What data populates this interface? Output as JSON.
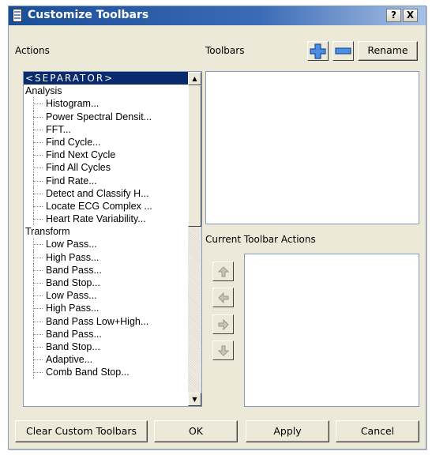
{
  "window": {
    "title": "Customize Toolbars",
    "help_label": "?",
    "close_label": "X"
  },
  "actions": {
    "label": "Actions",
    "items": [
      {
        "text": "<SEPARATOR>",
        "type": "selected"
      },
      {
        "text": "Analysis",
        "type": "group"
      },
      {
        "text": "Histogram...",
        "type": "child"
      },
      {
        "text": "Power Spectral Densit...",
        "type": "child"
      },
      {
        "text": "FFT...",
        "type": "child"
      },
      {
        "text": "Find Cycle...",
        "type": "child"
      },
      {
        "text": "Find Next Cycle",
        "type": "child"
      },
      {
        "text": "Find All Cycles",
        "type": "child"
      },
      {
        "text": "Find Rate...",
        "type": "child"
      },
      {
        "text": "Detect and Classify H...",
        "type": "child"
      },
      {
        "text": "Locate ECG Complex ...",
        "type": "child"
      },
      {
        "text": "Heart Rate Variability...",
        "type": "child"
      },
      {
        "text": "Transform",
        "type": "group"
      },
      {
        "text": "Low Pass...",
        "type": "child"
      },
      {
        "text": "High Pass...",
        "type": "child"
      },
      {
        "text": "Band Pass...",
        "type": "child"
      },
      {
        "text": "Band Stop...",
        "type": "child"
      },
      {
        "text": "Low Pass...",
        "type": "child"
      },
      {
        "text": "High Pass...",
        "type": "child"
      },
      {
        "text": "Band Pass Low+High...",
        "type": "child"
      },
      {
        "text": "Band Pass...",
        "type": "child"
      },
      {
        "text": "Band Stop...",
        "type": "child"
      },
      {
        "text": "Adaptive...",
        "type": "child"
      },
      {
        "text": "Comb Band Stop...",
        "type": "child"
      }
    ]
  },
  "toolbars": {
    "label": "Toolbars",
    "add_icon": "plus-icon",
    "remove_icon": "minus-icon",
    "rename_label": "Rename"
  },
  "current_actions": {
    "label": "Current Toolbar Actions",
    "up_icon": "arrow-up-icon",
    "left_icon": "arrow-left-icon",
    "right_icon": "arrow-right-icon",
    "down_icon": "arrow-down-icon"
  },
  "footer": {
    "clear_label": "Clear Custom Toolbars",
    "ok_label": "OK",
    "apply_label": "Apply",
    "cancel_label": "Cancel"
  },
  "colors": {
    "titlebar": "#1b4e98",
    "selection": "#0b2a6d",
    "dialog_bg": "#ece9d8",
    "add_blue": "#2a6fd0",
    "disabled_arrow": "#b8b4a4"
  }
}
